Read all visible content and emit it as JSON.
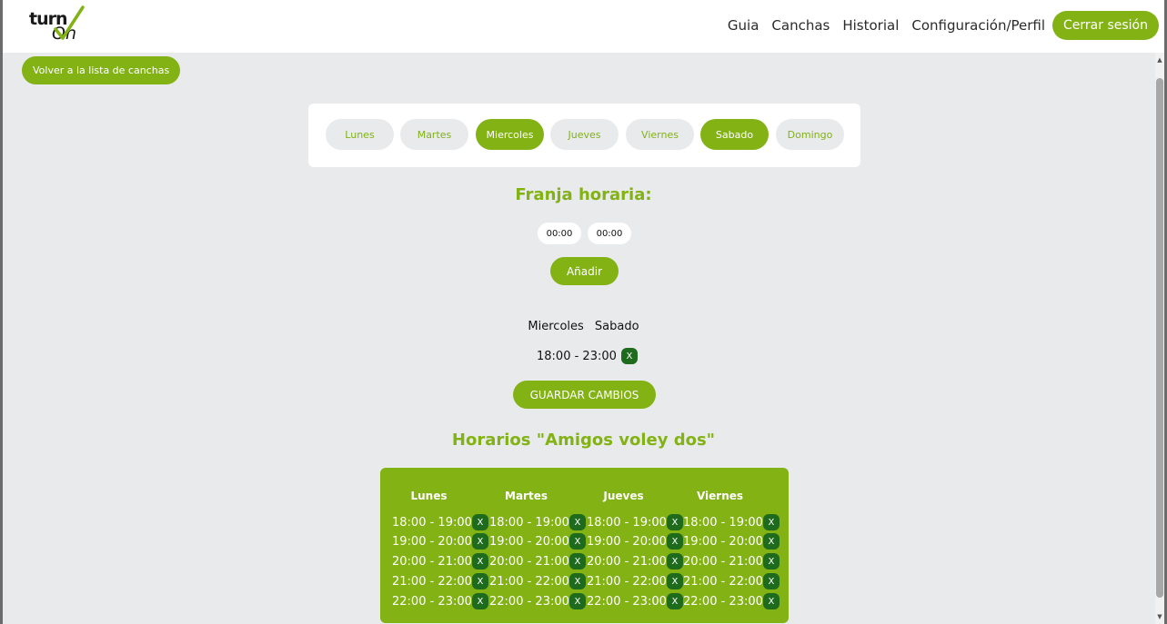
{
  "header": {
    "logo_line1": "turn",
    "logo_line2": "On",
    "nav": [
      "Guia",
      "Canchas",
      "Historial",
      "Configuración/Perfil"
    ],
    "logout_label": "Cerrar sesión",
    "accent_color": "#82b214"
  },
  "back_label": "Volver a la lista de canchas",
  "days": [
    {
      "label": "Lunes",
      "active": false
    },
    {
      "label": "Martes",
      "active": false
    },
    {
      "label": "Miercoles",
      "active": true
    },
    {
      "label": "Jueves",
      "active": false
    },
    {
      "label": "Viernes",
      "active": false
    },
    {
      "label": "Sabado",
      "active": true
    },
    {
      "label": "Domingo",
      "active": false
    }
  ],
  "time_range": {
    "title": "Franja horaria:",
    "start": "00:00",
    "end": "00:00",
    "add_label": "Añadir"
  },
  "selection": {
    "days": [
      "Miercoles",
      "Sabado"
    ],
    "slot": "18:00 - 23:00",
    "remove_label": "X"
  },
  "save_label": "GUARDAR CAMBIOS",
  "schedule": {
    "title": "Horarios \"Amigos voley dos\"",
    "remove_label": "X",
    "columns": [
      {
        "day": "Lunes",
        "slots": [
          "18:00 - 19:00",
          "19:00 - 20:00",
          "20:00 - 21:00",
          "21:00 - 22:00",
          "22:00 - 23:00"
        ]
      },
      {
        "day": "Martes",
        "slots": [
          "18:00 - 19:00",
          "19:00 - 20:00",
          "20:00 - 21:00",
          "21:00 - 22:00",
          "22:00 - 23:00"
        ]
      },
      {
        "day": "Jueves",
        "slots": [
          "18:00 - 19:00",
          "19:00 - 20:00",
          "20:00 - 21:00",
          "21:00 - 22:00",
          "22:00 - 23:00"
        ]
      },
      {
        "day": "Viernes",
        "slots": [
          "18:00 - 19:00",
          "19:00 - 20:00",
          "20:00 - 21:00",
          "21:00 - 22:00",
          "22:00 - 23:00"
        ]
      }
    ]
  }
}
